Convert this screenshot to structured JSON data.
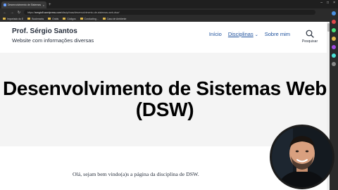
{
  "browser": {
    "tab_title": "Desenvolvimento de Sistemas Web",
    "new_tab": "+",
    "url_host": "sergio8.wordpress.com",
    "url_path": "/disciplinas/desenvolvimento-de-sistemas-web-dsw/",
    "bookmarks": [
      "Importado do E",
      "Bookmarks",
      "Grátis",
      "Códigos",
      "Conducting...",
      "Caso de Ambiente"
    ]
  },
  "site": {
    "title": "Prof. Sérgio Santos",
    "description": "Website com informações diversas",
    "nav": {
      "home": "Início",
      "disciplinas": "Disciplinas",
      "sobre": "Sobre mim"
    },
    "search_label": "Pesquisar"
  },
  "page": {
    "title": "Desenvolvimento de Sistemas Web (DSW)",
    "intro": "Olá, sejam bem vindo(a)s a página da disciplina de DSW."
  },
  "colors": {
    "link": "#1a4e9b",
    "hero_bg": "#f4f4f4",
    "text": "#28303d",
    "browser_chrome": "#2b2b2b"
  },
  "icons": {
    "search": "search-icon",
    "chevron": "chevron-down-icon",
    "webcam": "presenter-webcam"
  }
}
